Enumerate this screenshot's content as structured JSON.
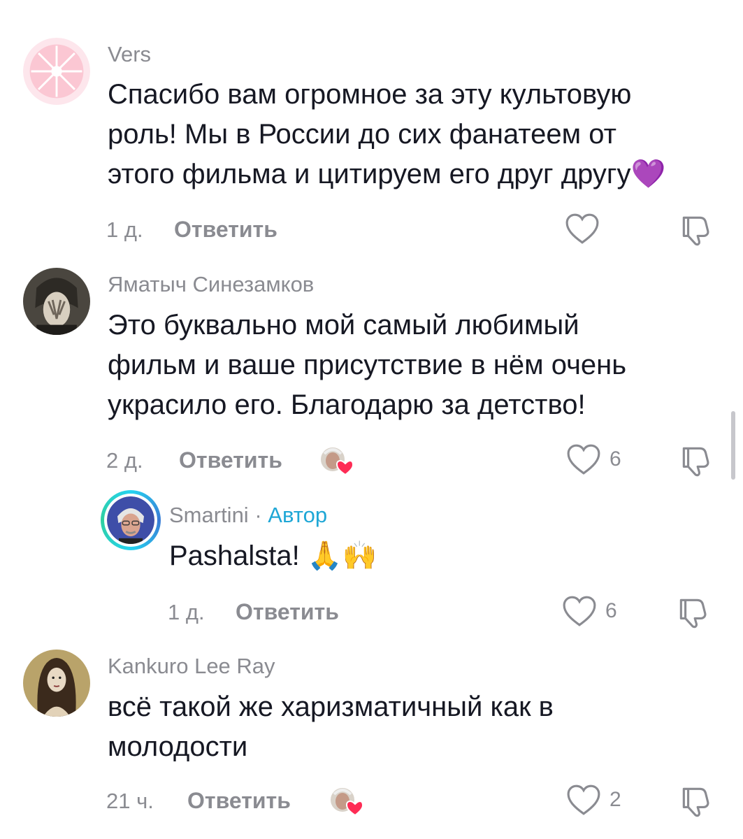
{
  "comments": [
    {
      "username": "Vers",
      "lines": [
        "Спасибо вам огромное за эту культовую",
        "роль! Мы в России до сих фанатеем от",
        "этого фильма и цитируем его друг другу💜"
      ],
      "time": "1 д.",
      "reply_label": "Ответить",
      "likes": "",
      "avatar": "pink-grapefruit-avatar"
    },
    {
      "username": "Яматыч Синезамков",
      "lines": [
        "Это буквально мой самый любимый",
        "фильм и ваше присутствие в нём очень",
        "украсило его. Благодарю за детство!"
      ],
      "time": "2 д.",
      "reply_label": "Ответить",
      "likes": "6",
      "avatar": "anime-character-avatar",
      "liked_by_creator": true
    },
    {
      "username": "Smartini",
      "separator": " · ",
      "author_tag": "Автор",
      "lines": [
        "Pashalsta! 🙏🙌"
      ],
      "time": "1 д.",
      "reply_label": "Ответить",
      "likes": "6",
      "avatar": "author-avatar"
    },
    {
      "username": "Kankuro Lee Ray",
      "lines": [
        "всё такой же харизматичный как в",
        "молодости"
      ],
      "time": "21 ч.",
      "reply_label": "Ответить",
      "likes": "2",
      "avatar": "portrait-painting-avatar",
      "liked_by_creator": true
    }
  ],
  "colors": {
    "text": "#161823",
    "secondary": "#8a8b91",
    "author_tag": "#1fa7d6",
    "heart": "#fe2c55"
  },
  "icons": {
    "like": "heart-outline-icon",
    "dislike": "thumbs-down-outline-icon",
    "creator_like": "creator-liked-heart-icon"
  }
}
